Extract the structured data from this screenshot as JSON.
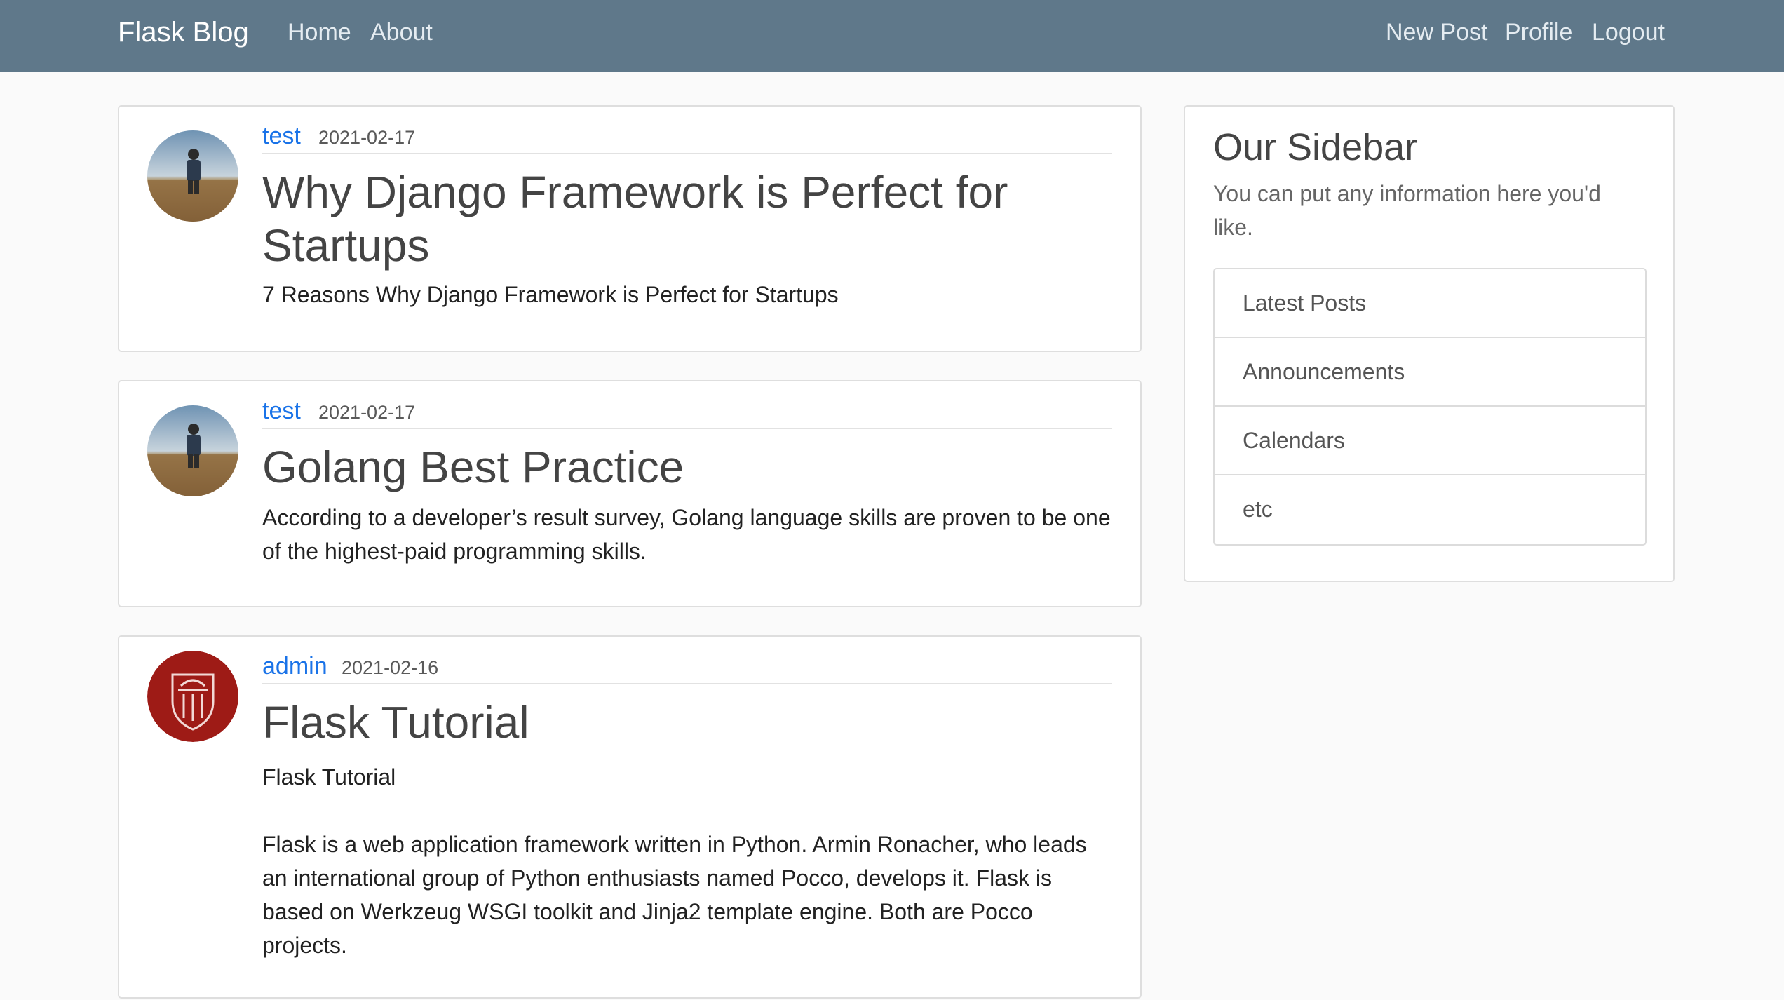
{
  "navbar": {
    "brand": "Flask Blog",
    "left_links": [
      "Home",
      "About"
    ],
    "right_links": [
      "New Post",
      "Profile",
      "Logout"
    ]
  },
  "posts": [
    {
      "author": "test",
      "date": "2021-02-17",
      "title": "Why Django Framework is Perfect for Startups",
      "content": "7 Reasons Why Django Framework is Perfect for Startups",
      "avatar": "landscape-person-avatar"
    },
    {
      "author": "test",
      "date": "2021-02-17",
      "title": "Golang Best Practice",
      "content": "According to a developer’s result survey, Golang language skills are proven to be one of the highest-paid programming skills.",
      "avatar": "landscape-person-avatar"
    },
    {
      "author": "admin",
      "date": "2021-02-16",
      "title": "Flask Tutorial",
      "content": "Flask Tutorial\n\nFlask is a web application framework written in Python. Armin Ronacher, who leads an international group of Python enthusiasts named Pocco, develops it. Flask is based on Werkzeug WSGI toolkit and Jinja2 template engine. Both are Pocco projects.",
      "avatar": "university-seal-avatar"
    }
  ],
  "sidebar": {
    "title": "Our Sidebar",
    "text": "You can put any information here you'd like.",
    "items": [
      "Latest Posts",
      "Announcements",
      "Calendars",
      "etc"
    ]
  },
  "colors": {
    "navbar": "#5f788a",
    "link": "#1a73e8",
    "seal": "#9e1b16"
  }
}
